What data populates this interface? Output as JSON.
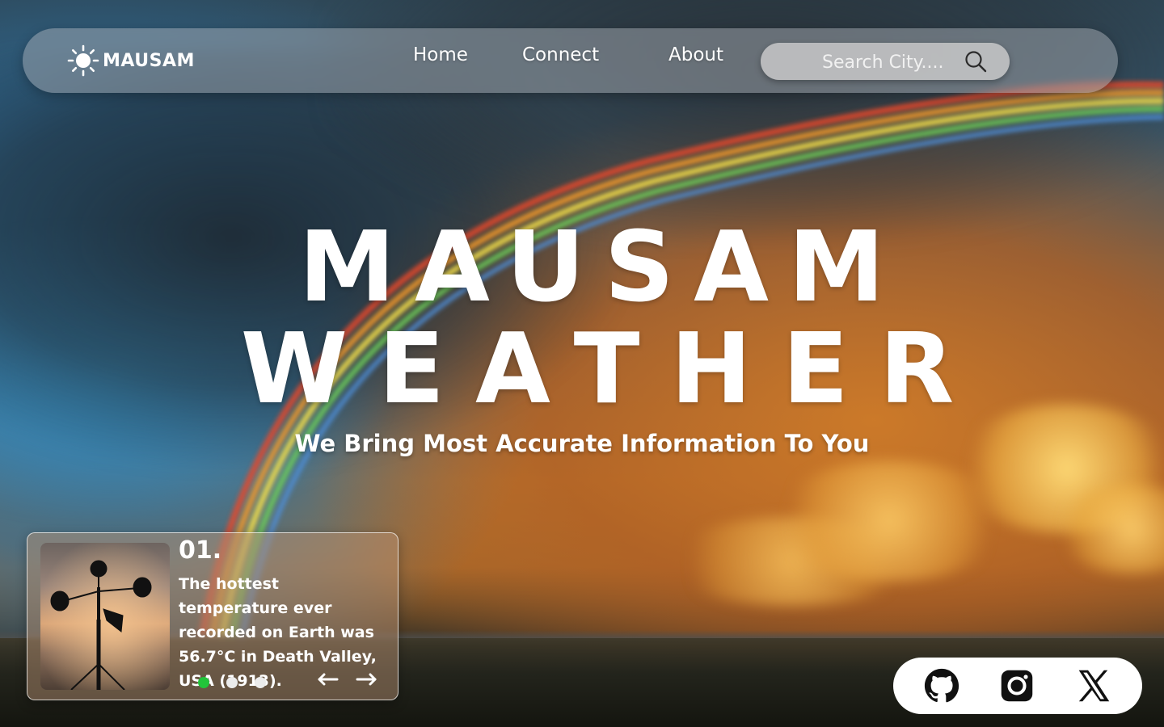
{
  "brand": {
    "name": "MAUSAM",
    "logo_icon": "sun-icon"
  },
  "nav": {
    "links": [
      {
        "label": "Home"
      },
      {
        "label": "Connect"
      },
      {
        "label": "About"
      }
    ],
    "search": {
      "placeholder": "Search City....",
      "value": "",
      "icon": "search-icon"
    }
  },
  "hero": {
    "title_line1": "MAUSAM",
    "title_line2": "WEATHER",
    "subtitle": "We Bring Most Accurate Information To You"
  },
  "fact_card": {
    "number": "01.",
    "text": "The hottest temperature ever recorded on Earth was 56.7°C in Death Valley, USA (1913).",
    "image": "anemometer-image",
    "slides": 3,
    "active_slide": 1,
    "active_dot_color": "#22c43a"
  },
  "socials": [
    {
      "name": "github-icon"
    },
    {
      "name": "instagram-icon"
    },
    {
      "name": "x-icon"
    }
  ],
  "colors": {
    "accent_green": "#22c43a",
    "text": "#ffffff"
  }
}
